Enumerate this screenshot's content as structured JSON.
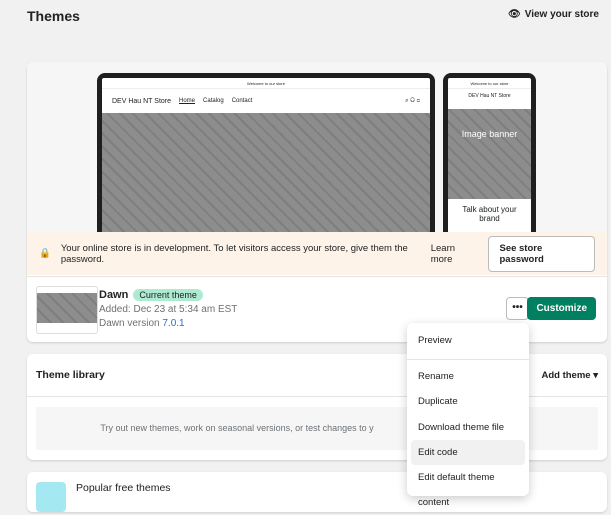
{
  "header": {
    "title": "Themes",
    "view_store": "View your store"
  },
  "preview": {
    "announcement": "Welcome to our store",
    "store_name": "DEV Hau NT Store",
    "nav": [
      "Home",
      "Catalog",
      "Contact"
    ],
    "mobile_banner": "Image banner",
    "mobile_heading": "Talk about your brand"
  },
  "banner": {
    "message": "Your online store is in development. To let visitors access your store, give them the password.",
    "learn_more": "Learn more",
    "see_password": "See store password"
  },
  "current_theme": {
    "name": "Dawn",
    "badge": "Current theme",
    "added": "Added: Dec 23 at 5:34 am EST",
    "version_prefix": "Dawn version ",
    "version": "7.0.1",
    "actions_label": "•••",
    "customize": "Customize"
  },
  "menu": {
    "items": [
      "Preview",
      "Rename",
      "Duplicate",
      "Download theme file",
      "Edit code",
      "Edit default theme content"
    ]
  },
  "library": {
    "title": "Theme library",
    "add_theme": "Add theme",
    "empty_text": "Try out new themes, work on seasonal versions, or test changes to y"
  },
  "popular": {
    "title": "Popular free themes"
  }
}
